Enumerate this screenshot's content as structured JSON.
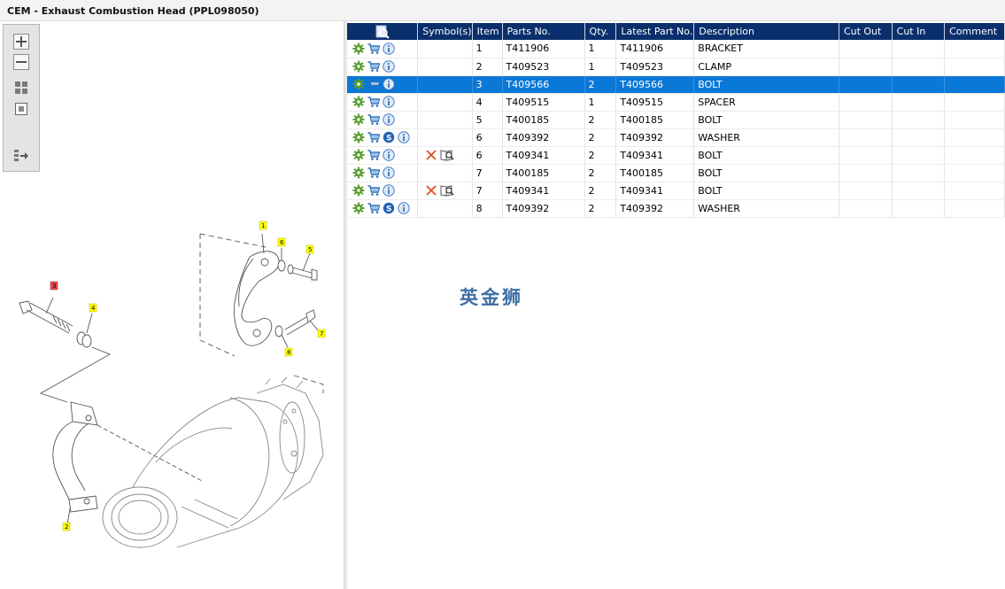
{
  "window": {
    "title": "CEM - Exhaust Combustion Head (PPL098050)"
  },
  "toolbox": {
    "tools": [
      "zoom-in",
      "zoom-out",
      "fit-all",
      "actual-size",
      "export"
    ]
  },
  "drawing": {
    "callouts": [
      "1",
      "6",
      "5",
      "3",
      "4",
      "7",
      "8",
      "2"
    ],
    "highlighted_callout": "3",
    "highlight_color": "#e8484e",
    "callout_color": "#ffff00"
  },
  "table": {
    "columns": [
      "",
      "Symbol(s)",
      "Item",
      "Parts No.",
      "Qty.",
      "Latest Part No.",
      "Description",
      "Cut Out",
      "Cut In",
      "Comment"
    ],
    "header_color": "#0a2f6c",
    "selected_color": "#0a78d7",
    "rows": [
      {
        "item": "1",
        "parts_no": "T411906",
        "qty": "1",
        "latest": "T411906",
        "desc": "BRACKET",
        "s_icon": false,
        "symbols": false,
        "selected": false
      },
      {
        "item": "2",
        "parts_no": "T409523",
        "qty": "1",
        "latest": "T409523",
        "desc": "CLAMP",
        "s_icon": false,
        "symbols": false,
        "selected": false
      },
      {
        "item": "3",
        "parts_no": "T409566",
        "qty": "2",
        "latest": "T409566",
        "desc": "BOLT",
        "s_icon": false,
        "symbols": false,
        "selected": true
      },
      {
        "item": "4",
        "parts_no": "T409515",
        "qty": "1",
        "latest": "T409515",
        "desc": "SPACER",
        "s_icon": false,
        "symbols": false,
        "selected": false
      },
      {
        "item": "5",
        "parts_no": "T400185",
        "qty": "2",
        "latest": "T400185",
        "desc": "BOLT",
        "s_icon": false,
        "symbols": false,
        "selected": false
      },
      {
        "item": "6",
        "parts_no": "T409392",
        "qty": "2",
        "latest": "T409392",
        "desc": "WASHER",
        "s_icon": true,
        "symbols": false,
        "selected": false
      },
      {
        "item": "6",
        "parts_no": "T409341",
        "qty": "2",
        "latest": "T409341",
        "desc": "BOLT",
        "s_icon": false,
        "symbols": true,
        "selected": false
      },
      {
        "item": "7",
        "parts_no": "T400185",
        "qty": "2",
        "latest": "T400185",
        "desc": "BOLT",
        "s_icon": false,
        "symbols": false,
        "selected": false
      },
      {
        "item": "7",
        "parts_no": "T409341",
        "qty": "2",
        "latest": "T409341",
        "desc": "BOLT",
        "s_icon": false,
        "symbols": true,
        "selected": false
      },
      {
        "item": "8",
        "parts_no": "T409392",
        "qty": "2",
        "latest": "T409392",
        "desc": "WASHER",
        "s_icon": true,
        "symbols": false,
        "selected": false
      }
    ]
  },
  "watermark": "英金狮"
}
